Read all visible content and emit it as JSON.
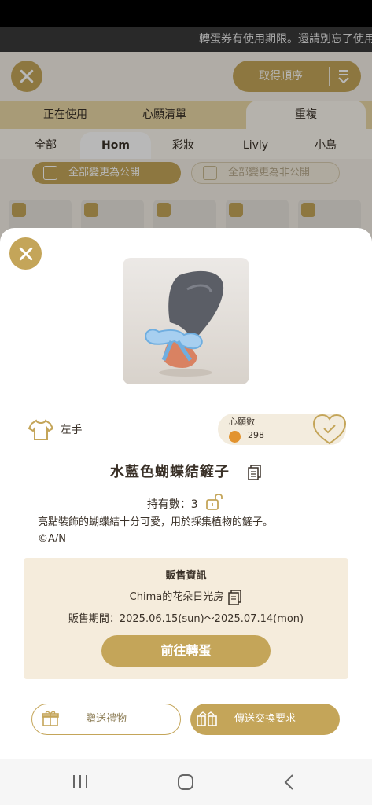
{
  "marquee": {
    "text": "轉蛋券有使用期限。還請別忘了使用"
  },
  "background": {
    "sort_label": "取得順序",
    "tabs": [
      {
        "label": "正在使用"
      },
      {
        "label": "心願清單"
      },
      {
        "label": "重複"
      }
    ],
    "categories": [
      {
        "label": "全部"
      },
      {
        "label": "Hom"
      },
      {
        "label": "彩妝"
      },
      {
        "label": "Livly"
      },
      {
        "label": "小島"
      }
    ],
    "public_button": "全部變更為公開",
    "private_button": "全部變更為非公開"
  },
  "item": {
    "slot": "左手",
    "wish_label": "心願數",
    "wish_count": "298",
    "name": "水藍色蝴蝶結鏟子",
    "owned": "持有數：3",
    "description": "亮點裝飾的蝴蝶結十分可愛，用於採集植物的鏟子。",
    "copyright": "©A/N"
  },
  "sale": {
    "title": "販售資訊",
    "shop": "Chima的花朵日光房",
    "period": "販售期間：2025.06.15(sun)～2025.07.14(mon)",
    "gacha_button": "前往轉蛋"
  },
  "actions": {
    "gift": "贈送禮物",
    "trade": "傳送交換要求"
  },
  "colors": {
    "gold": "#c4a559",
    "cream": "#f5ecdc",
    "text": "#3a3128"
  }
}
